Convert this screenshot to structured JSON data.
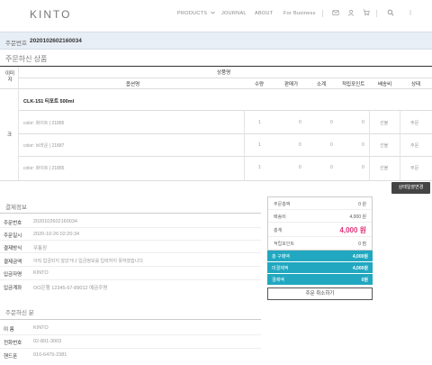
{
  "header": {
    "logo": "KINTO",
    "nav": [
      "PRODUCTS",
      "JOURNAL",
      "ABOUT",
      "For Business"
    ]
  },
  "order": {
    "label": "주문번호",
    "number": "2020102602160034"
  },
  "products_section": {
    "title": "주문하신 상품",
    "col_image": "이미지",
    "col_product": "상품명",
    "col_option": "옵션명",
    "col_qty": "수량",
    "col_price": "판매가",
    "col_subtotal": "소계",
    "col_points": "적립포인트",
    "col_shipping": "배송비",
    "col_status": "상태",
    "product_name": "CLK-151 티포트 500ml",
    "image_alt": "크",
    "rows": [
      {
        "option": "color: 화이트 | 21885",
        "qty": "1",
        "price": "0",
        "subtotal": "0",
        "points": "0",
        "shipping": "선불",
        "status": "주문"
      },
      {
        "option": "color: 브라운 | 21887",
        "qty": "1",
        "price": "0",
        "subtotal": "0",
        "points": "0",
        "shipping": "선불",
        "status": "주문"
      },
      {
        "option": "color: 화이트 | 21885",
        "qty": "1",
        "price": "0",
        "subtotal": "0",
        "points": "0",
        "shipping": "선불",
        "status": "주문"
      }
    ],
    "status_change_button": "상태일괄변경"
  },
  "payment": {
    "title": "결제정보",
    "rows": [
      {
        "label": "주문번호",
        "value": "2020102602160034"
      },
      {
        "label": "주문일시",
        "value": "2020-10-26 02:20:34"
      },
      {
        "label": "결제방식",
        "value": "무통장"
      },
      {
        "label": "결제금액",
        "value": "아직 입금되지 않았거나 입금정보를 입력하지 못하였습니다"
      },
      {
        "label": "입금자명",
        "value": "KINTO"
      },
      {
        "label": "입금계좌",
        "value": "OO은행 12345-67-89012 예금주명"
      }
    ]
  },
  "summary": {
    "rows": [
      {
        "label": "주문총액",
        "value": "0 원"
      },
      {
        "label": "배송비",
        "value": "4,000 원"
      }
    ],
    "total_label": "총계",
    "total_value": "4,000 원",
    "points_label": "적립포인트",
    "points_value": "0 점",
    "teal_rows": [
      {
        "label": "총 구매액",
        "value": "4,000원"
      },
      {
        "label": "미결제액",
        "value": "4,000원"
      },
      {
        "label": "결제액",
        "value": "0원"
      }
    ],
    "cancel_button": "주문 취소하기"
  },
  "orderer": {
    "title": "주문하신 분",
    "rows": [
      {
        "label": "이 름",
        "value": "KINTO"
      },
      {
        "label": "전화번호",
        "value": "02-891-3003"
      },
      {
        "label": "핸드폰",
        "value": "010-6479-2381"
      }
    ]
  },
  "colors": {
    "accent_teal": "#21a8c0",
    "total_pink": "#e0337a",
    "orderbar_bg": "#e8eef6"
  }
}
